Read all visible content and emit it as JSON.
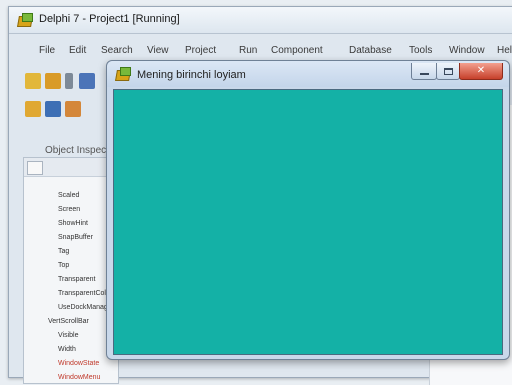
{
  "ide": {
    "title": "Delphi 7 - Project1 [Running]",
    "menu": [
      "File",
      "Edit",
      "Search",
      "View",
      "Project",
      "Run",
      "Component",
      "Database",
      "Tools",
      "Window",
      "Help"
    ]
  },
  "object_inspector": {
    "caption": "Object Inspector",
    "properties": [
      "Scaled",
      "Screen",
      "ShowHint",
      "SnapBuffer",
      "Tag",
      "Top",
      "Transparent",
      "TransparentColor",
      "UseDockManager",
      "VertScrollBar",
      "Visible",
      "Width",
      "WindowState",
      "WindowMenu"
    ]
  },
  "form": {
    "title": "Mening birinchi loyiam",
    "client_color": "#14b1a6"
  },
  "colors": {
    "accent": "#14b1a6",
    "close_red": "#c6402b"
  },
  "icons": [
    "delphi-app-icon",
    "minimize-icon",
    "maximize-icon",
    "close-icon"
  ]
}
